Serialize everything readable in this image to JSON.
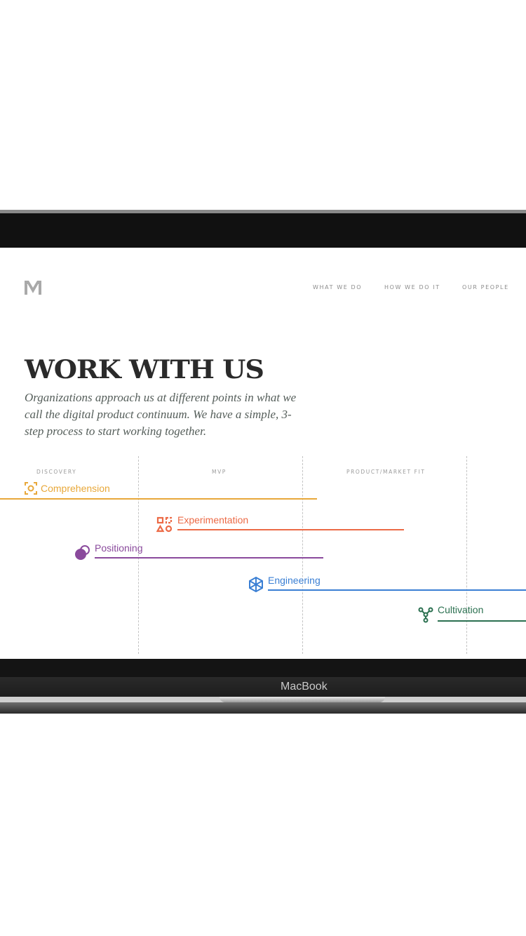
{
  "device": {
    "label": "MacBook"
  },
  "nav": {
    "items": [
      "WHAT WE DO",
      "HOW WE DO IT",
      "OUR PEOPLE"
    ]
  },
  "hero": {
    "title": "WORK WITH US",
    "intro": "Organizations approach us at different points in what we call the digital product continuum. We have a simple, 3-step process to start working together."
  },
  "stages": [
    "DISCOVERY",
    "MVP",
    "PRODUCT/MARKET FIT"
  ],
  "phases": [
    {
      "label": "Comprehension",
      "icon": "focus-icon",
      "color": "#e8a83a"
    },
    {
      "label": "Experimentation",
      "icon": "shapes-icon",
      "color": "#ec6a46"
    },
    {
      "label": "Positioning",
      "icon": "overlap-circles-icon",
      "color": "#8a4a9c"
    },
    {
      "label": "Engineering",
      "icon": "cube-icon",
      "color": "#3a7fd4"
    },
    {
      "label": "Cultivation",
      "icon": "network-icon",
      "color": "#2b7050"
    }
  ],
  "colors": {
    "heading": "#2a2a2a",
    "text": "#555e5a",
    "nav": "#8c8c8c"
  }
}
